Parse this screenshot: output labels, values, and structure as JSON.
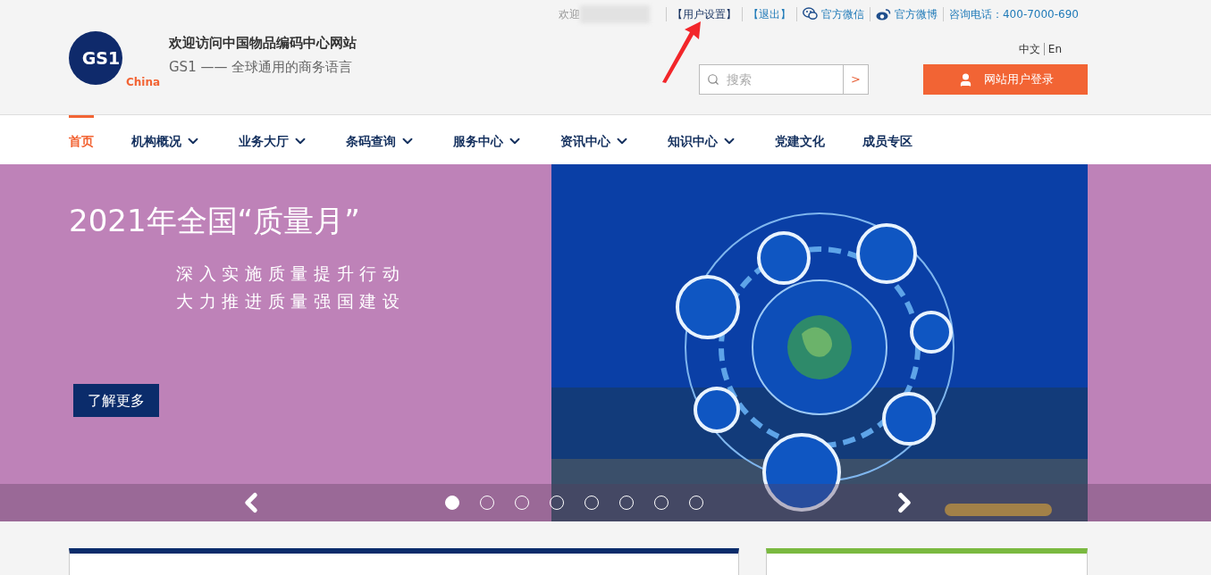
{
  "top_bar": {
    "welcome": "欢迎",
    "links": [
      {
        "label": "【用户设置】",
        "kind": "settings"
      },
      {
        "label": "【退出】",
        "kind": "logout"
      },
      {
        "label": "官方微信",
        "kind": "wechat"
      },
      {
        "label": "官方微博",
        "kind": "weibo"
      },
      {
        "label": "咨询电话：400-7000-690",
        "kind": "phone"
      }
    ]
  },
  "header": {
    "logo_mark": "GS1",
    "logo_sub": "China",
    "title": "欢迎访问中国物品编码中心网站",
    "subtitle": "GS1 —— 全球通用的商务语言",
    "languages": [
      {
        "label": "中文"
      },
      {
        "label": "En"
      }
    ],
    "search": {
      "placeholder": "搜索",
      "submit": ">"
    },
    "login_button": "网站用户登录"
  },
  "nav": [
    {
      "label": "首页",
      "selected": true,
      "dropdown": false
    },
    {
      "label": "机构概况",
      "selected": false,
      "dropdown": true
    },
    {
      "label": "业务大厅",
      "selected": false,
      "dropdown": true
    },
    {
      "label": "条码查询",
      "selected": false,
      "dropdown": true
    },
    {
      "label": "服务中心",
      "selected": false,
      "dropdown": true
    },
    {
      "label": "资讯中心",
      "selected": false,
      "dropdown": true
    },
    {
      "label": "知识中心",
      "selected": false,
      "dropdown": true
    },
    {
      "label": "党建文化",
      "selected": false,
      "dropdown": false
    },
    {
      "label": "成员专区",
      "selected": false,
      "dropdown": false
    }
  ],
  "banner": {
    "title": "2021年全国“质量月”",
    "slogans": [
      "深入实施质量提升行动",
      "大力推进质量强国建设"
    ],
    "button": "了解更多",
    "slides": [
      {
        "selected": true
      },
      {
        "selected": false
      },
      {
        "selected": false
      },
      {
        "selected": false
      },
      {
        "selected": false
      },
      {
        "selected": false
      },
      {
        "selected": false
      },
      {
        "selected": false
      }
    ]
  },
  "cards": [
    {
      "color": "#0b2c6b"
    },
    {
      "color": "#7ab940"
    }
  ]
}
